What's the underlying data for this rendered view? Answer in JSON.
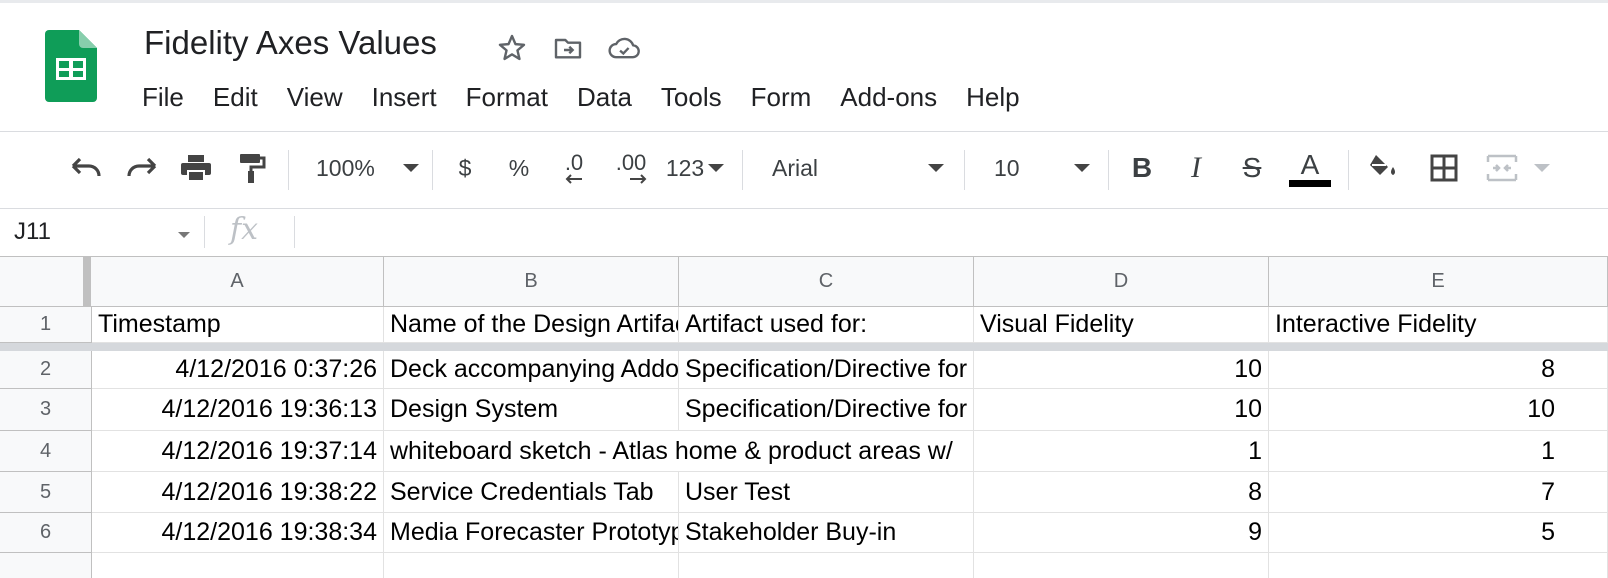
{
  "doc": {
    "title": "Fidelity Axes Values",
    "title_icons": [
      "star-icon",
      "move-to-folder-icon",
      "cloud-saved-icon"
    ]
  },
  "menu": [
    "File",
    "Edit",
    "View",
    "Insert",
    "Format",
    "Data",
    "Tools",
    "Form",
    "Add-ons",
    "Help"
  ],
  "toolbar": {
    "zoom": "100%",
    "currency": "$",
    "percent": "%",
    "decrease_decimal": ".0",
    "increase_decimal": ".00",
    "more_formats": "123",
    "font": "Arial",
    "font_size": "10",
    "bold": "B",
    "italic": "I",
    "strike": "S",
    "text_color": "A"
  },
  "formula_bar": {
    "name_box": "J11",
    "fx": "fx",
    "value": ""
  },
  "grid": {
    "columns": [
      "A",
      "B",
      "C",
      "D",
      "E"
    ],
    "rows": [
      "1",
      "2",
      "3",
      "4",
      "5",
      "6"
    ],
    "header_row": [
      "Timestamp",
      "Name of the Design Artifact",
      "Artifact used for:",
      "Visual Fidelity",
      "Interactive Fidelity"
    ],
    "data_rows": [
      [
        "4/12/2016 0:37:26",
        "Deck accompanying Addon",
        "Specification/Directive for",
        "10",
        "8"
      ],
      [
        "4/12/2016 19:36:13",
        "Design System",
        "Specification/Directive for",
        "10",
        "10"
      ],
      [
        "4/12/2016 19:37:14",
        "whiteboard sketch - Atlas home & product areas w/",
        "",
        "1",
        "1"
      ],
      [
        "4/12/2016 19:38:22",
        "Service Credentials Tab",
        "User Test",
        "8",
        "7"
      ],
      [
        "4/12/2016 19:38:34",
        "Media Forecaster Prototype",
        "Stakeholder Buy-in",
        "9",
        "5"
      ]
    ]
  },
  "colors": {
    "logo_green": "#0f9d58",
    "grid_header_bg": "#f8f9fa",
    "freeze_bar": "#d5d8dc"
  }
}
